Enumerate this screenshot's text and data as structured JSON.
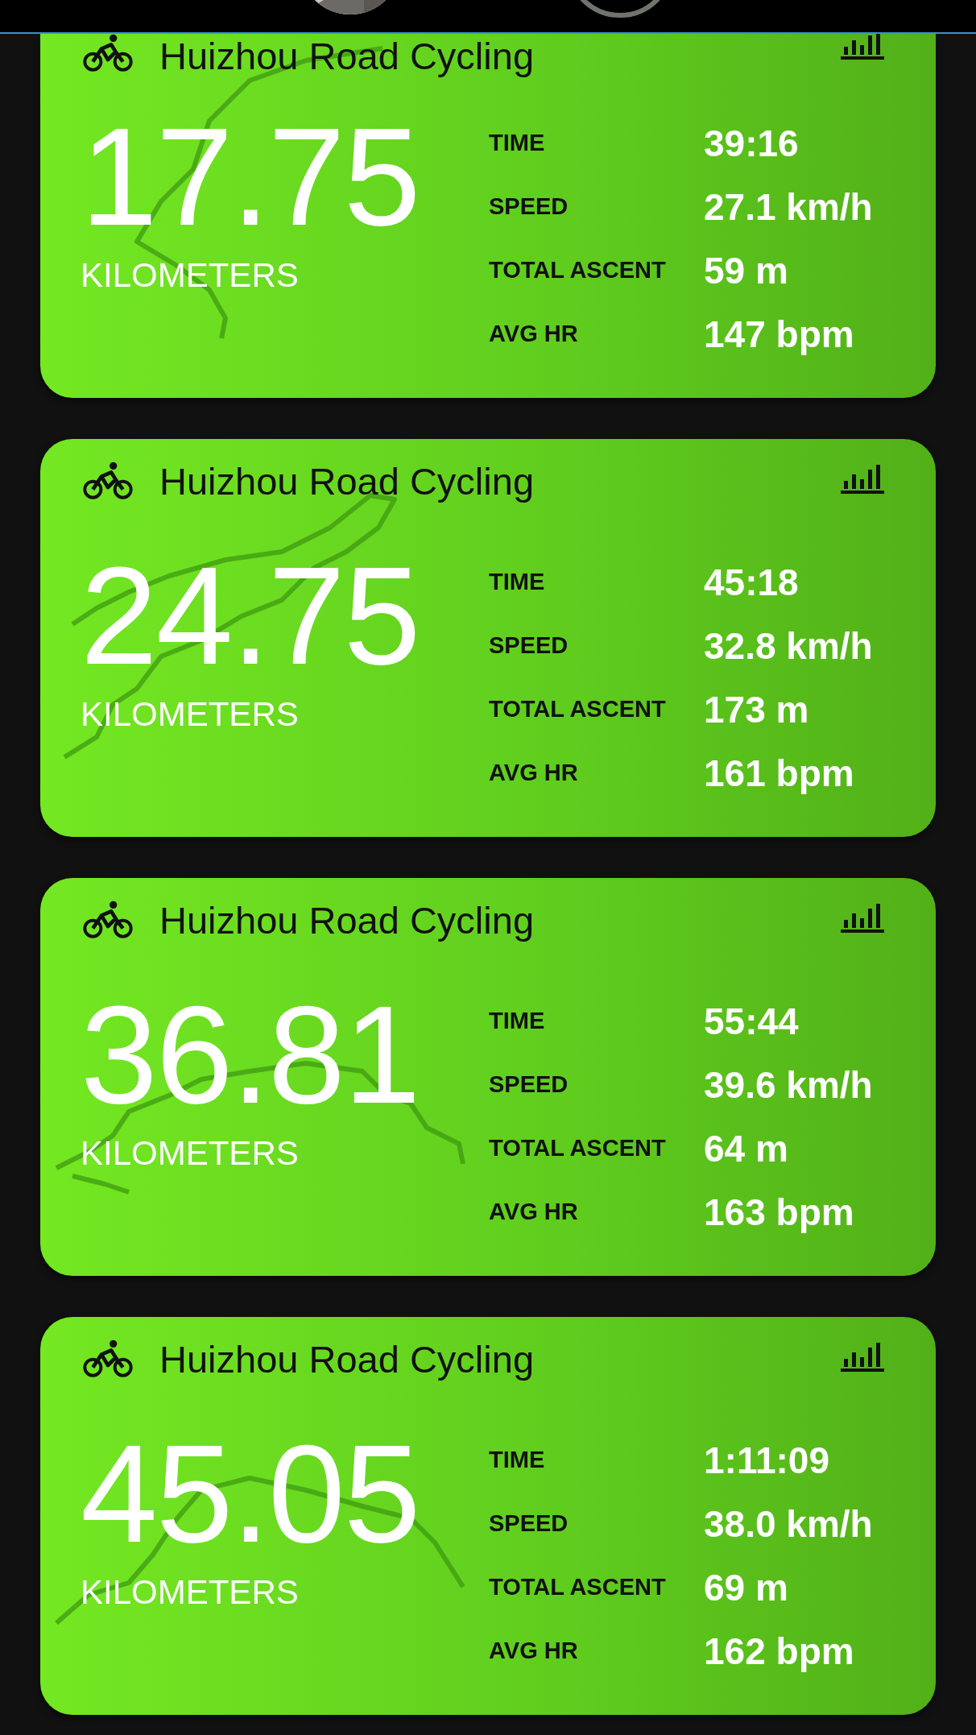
{
  "activities": [
    {
      "title": "Huizhou Road Cycling",
      "distance": "17.75",
      "unit": "KILOMETERS",
      "stats": [
        {
          "label": "TIME",
          "value": "39:16"
        },
        {
          "label": "SPEED",
          "value": "27.1 km/h"
        },
        {
          "label": "TOTAL ASCENT",
          "value": "59 m"
        },
        {
          "label": "AVG HR",
          "value": "147 bpm"
        }
      ]
    },
    {
      "title": "Huizhou Road Cycling",
      "distance": "24.75",
      "unit": "KILOMETERS",
      "stats": [
        {
          "label": "TIME",
          "value": "45:18"
        },
        {
          "label": "SPEED",
          "value": "32.8 km/h"
        },
        {
          "label": "TOTAL ASCENT",
          "value": "173 m"
        },
        {
          "label": "AVG HR",
          "value": "161 bpm"
        }
      ]
    },
    {
      "title": "Huizhou Road Cycling",
      "distance": "36.81",
      "unit": "KILOMETERS",
      "stats": [
        {
          "label": "TIME",
          "value": "55:44"
        },
        {
          "label": "SPEED",
          "value": "39.6 km/h"
        },
        {
          "label": "TOTAL ASCENT",
          "value": "64 m"
        },
        {
          "label": "AVG HR",
          "value": "163 bpm"
        }
      ]
    },
    {
      "title": "Huizhou Road Cycling",
      "distance": "45.05",
      "unit": "KILOMETERS",
      "stats": [
        {
          "label": "TIME",
          "value": "1:11:09"
        },
        {
          "label": "SPEED",
          "value": "38.0 km/h"
        },
        {
          "label": "TOTAL ASCENT",
          "value": "69 m"
        },
        {
          "label": "AVG HR",
          "value": "162 bpm"
        }
      ]
    }
  ]
}
